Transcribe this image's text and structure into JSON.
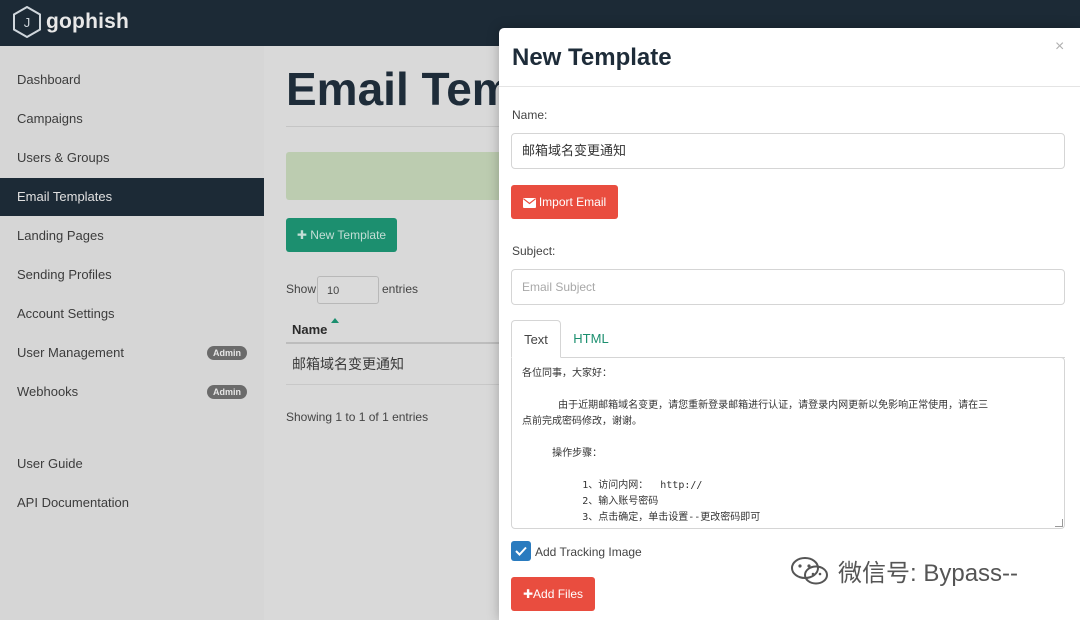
{
  "brand": {
    "name": "gophish",
    "logo_letter": "J"
  },
  "sidebar": {
    "items": [
      {
        "label": "Dashboard",
        "active": false
      },
      {
        "label": "Campaigns",
        "active": false
      },
      {
        "label": "Users & Groups",
        "active": false
      },
      {
        "label": "Email Templates",
        "active": true
      },
      {
        "label": "Landing Pages",
        "active": false
      },
      {
        "label": "Sending Profiles",
        "active": false
      },
      {
        "label": "Account Settings",
        "active": false
      },
      {
        "label": "User Management",
        "active": false,
        "badge": "Admin"
      },
      {
        "label": "Webhooks",
        "active": false,
        "badge": "Admin"
      }
    ],
    "footer_items": [
      {
        "label": "User Guide"
      },
      {
        "label": "API Documentation"
      }
    ]
  },
  "main": {
    "title": "Email Tem",
    "new_template_button": "New Template",
    "show_label": "Show",
    "entries_value": "10",
    "entries_label": "entries",
    "table": {
      "columns": [
        "Name"
      ],
      "rows": [
        {
          "name": "邮箱域名变更通知"
        }
      ]
    },
    "showing_text": "Showing 1 to 1 of 1 entries"
  },
  "modal": {
    "title": "New Template",
    "close_symbol": "×",
    "name_label": "Name:",
    "name_value": "邮箱域名变更通知",
    "import_button": "Import Email",
    "subject_label": "Subject:",
    "subject_placeholder": "Email Subject",
    "tabs": [
      {
        "label": "Text",
        "active": true
      },
      {
        "label": "HTML",
        "active": false
      }
    ],
    "body_lines": [
      "各位同事，大家好：",
      "",
      "      由于近期邮箱域名变更，请您重新登录邮箱进行认证，请登录内网更新以免影响正常使用，请在三",
      "点前完成密码修改，谢谢。",
      "",
      "     操作步骤：",
      "",
      "          1、访问内网：  http://",
      "          2、输入账号密码",
      "          3、点击确定，单击设置--更改密码即可"
    ],
    "tracking_label": "Add Tracking Image",
    "tracking_checked": true,
    "add_files_button": "Add Files"
  },
  "watermark": {
    "text": "微信号: Bypass--"
  },
  "colors": {
    "navy": "#1c2a36",
    "green": "#1c8f6f",
    "red": "#e94d3f",
    "blue": "#2a7bbf"
  }
}
